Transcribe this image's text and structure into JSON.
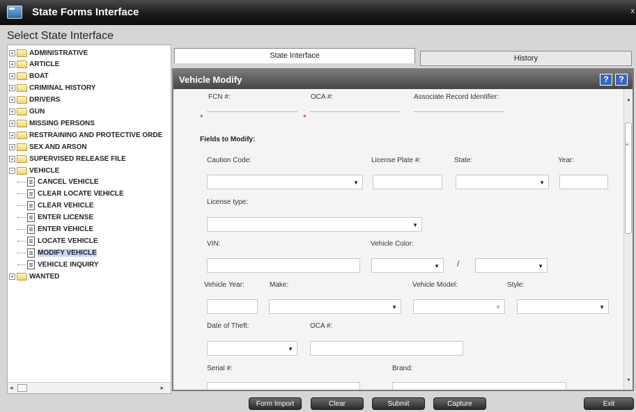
{
  "window": {
    "title": "State Forms Interface",
    "close_glyph": "x"
  },
  "panel_label": "Select State Interface",
  "tree": {
    "items": [
      {
        "label": "ADMINISTRATIVE",
        "type": "folder"
      },
      {
        "label": "ARTICLE",
        "type": "folder"
      },
      {
        "label": "BOAT",
        "type": "folder"
      },
      {
        "label": "CRIMINAL HISTORY",
        "type": "folder"
      },
      {
        "label": "DRIVERS",
        "type": "folder"
      },
      {
        "label": "GUN",
        "type": "folder"
      },
      {
        "label": "MISSING PERSONS",
        "type": "folder"
      },
      {
        "label": "RESTRAINING AND PROTECTIVE ORDE",
        "type": "folder"
      },
      {
        "label": "SEX AND ARSON",
        "type": "folder"
      },
      {
        "label": "SUPERVISED RELEASE FILE",
        "type": "folder"
      },
      {
        "label": "VEHICLE",
        "type": "folder-open"
      },
      {
        "label": "CANCEL VEHICLE",
        "type": "doc"
      },
      {
        "label": "CLEAR LOCATE VEHICLE",
        "type": "doc"
      },
      {
        "label": "CLEAR VEHICLE",
        "type": "doc"
      },
      {
        "label": "ENTER LICENSE",
        "type": "doc"
      },
      {
        "label": "ENTER VEHICLE",
        "type": "doc"
      },
      {
        "label": "LOCATE VEHICLE",
        "type": "doc"
      },
      {
        "label": "MODIFY VEHICLE",
        "type": "doc",
        "selected": true
      },
      {
        "label": "VEHICLE INQUIRY",
        "type": "doc"
      },
      {
        "label": "WANTED",
        "type": "folder"
      }
    ]
  },
  "tabs": {
    "active": "State Interface",
    "inactive": "History"
  },
  "form": {
    "title": "Vehicle Modify",
    "help_icons": [
      "?",
      "?"
    ],
    "fcn_label": "FCN #:",
    "oca_label": "OCA #:",
    "ari_label": "Associate Record Identifier:",
    "fields_to_modify": "Fields to Modify:",
    "caution_code": "Caution Code:",
    "license_plate": "License Plate #:",
    "state": "State:",
    "year": "Year:",
    "license_type": "License type:",
    "vin": "VIN:",
    "vehicle_color": "Vehicle Color:",
    "color_separator": "/",
    "vehicle_year": "Vehicle Year:",
    "make": "Make:",
    "vehicle_model": "Vehicle Model:",
    "style": "Style:",
    "date_of_theft": "Date of Theft:",
    "oca2": "OCA #:",
    "serial": "Serial #:",
    "brand": "Brand:"
  },
  "buttons": {
    "form_import": "Form Import",
    "clear": "Clear",
    "submit": "Submit",
    "capture": "Capture",
    "exit": "Exit"
  },
  "icons": {
    "app": "folder-window-icon",
    "help": "help-icon",
    "expand": "expand-icon",
    "folder": "folder-icon",
    "document": "document-icon",
    "dropdown": "chevron-down-icon"
  },
  "colors": {
    "header_bg": "#4a4a4a",
    "help_bg": "#3b67b5",
    "required": "#d21f1f",
    "selected_bg": "#c7d6f5"
  }
}
